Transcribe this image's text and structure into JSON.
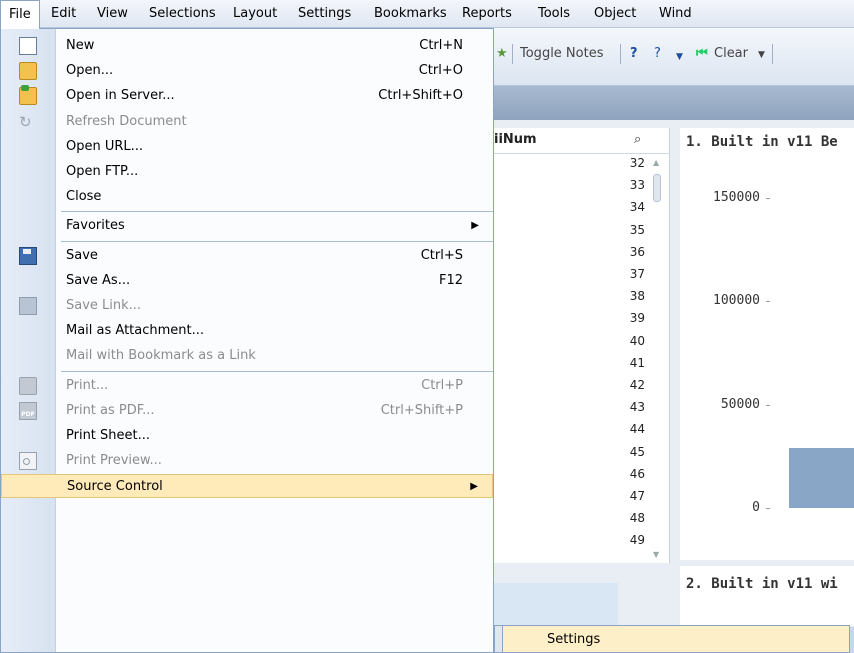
{
  "menubar": {
    "items": [
      "File",
      "Edit",
      "View",
      "Selections",
      "Layout",
      "Settings",
      "Bookmarks",
      "Reports",
      "Tools",
      "Object",
      "Wind"
    ]
  },
  "toolbar": {
    "toggle_notes": "Toggle Notes",
    "help_q": "?",
    "clear": "Clear"
  },
  "listbox": {
    "title": "iiNum",
    "search_icon": "search-icon",
    "values": [
      "32",
      "33",
      "34",
      "35",
      "36",
      "37",
      "38",
      "39",
      "40",
      "41",
      "42",
      "43",
      "44",
      "45",
      "46",
      "47",
      "48",
      "49"
    ]
  },
  "chart_data": {
    "type": "bar",
    "title": "1. Built in v11 Be",
    "yticks": [
      "150000",
      "100000",
      "50000",
      "0"
    ],
    "ylim": [
      0,
      150000
    ],
    "values": [
      29000
    ]
  },
  "chart2": {
    "title": "2. Built in v11 wi"
  },
  "file_menu": {
    "items": [
      {
        "label": "New",
        "shortcut": "Ctrl+N",
        "icon": "new-document-icon",
        "disabled": false
      },
      {
        "label": "Open...",
        "shortcut": "Ctrl+O",
        "icon": "open-folder-icon",
        "disabled": false
      },
      {
        "label": "Open in Server...",
        "shortcut": "Ctrl+Shift+O",
        "icon": "open-server-icon",
        "disabled": false
      },
      {
        "label": "Refresh Document",
        "shortcut": "",
        "icon": "refresh-icon",
        "disabled": true
      },
      {
        "label": "Open URL...",
        "shortcut": "",
        "icon": "",
        "disabled": false
      },
      {
        "label": "Open FTP...",
        "shortcut": "",
        "icon": "",
        "disabled": false
      },
      {
        "label": "Close",
        "shortcut": "",
        "icon": "",
        "disabled": false
      },
      {
        "label": "Favorites",
        "shortcut": "",
        "icon": "",
        "disabled": false,
        "submenu": true
      },
      {
        "label": "Save",
        "shortcut": "Ctrl+S",
        "icon": "save-icon",
        "disabled": false
      },
      {
        "label": "Save As...",
        "shortcut": "F12",
        "icon": "",
        "disabled": false
      },
      {
        "label": "Save Link...",
        "shortcut": "",
        "icon": "save-link-icon",
        "disabled": true
      },
      {
        "label": "Mail as Attachment...",
        "shortcut": "",
        "icon": "",
        "disabled": false
      },
      {
        "label": "Mail with Bookmark as a Link",
        "shortcut": "",
        "icon": "",
        "disabled": true
      },
      {
        "label": "Print...",
        "shortcut": "Ctrl+P",
        "icon": "print-icon",
        "disabled": true
      },
      {
        "label": "Print as PDF...",
        "shortcut": "Ctrl+Shift+P",
        "icon": "print-pdf-icon",
        "disabled": true
      },
      {
        "label": "Print Sheet...",
        "shortcut": "",
        "icon": "",
        "disabled": false
      },
      {
        "label": "Print Preview...",
        "shortcut": "",
        "icon": "print-preview-icon",
        "disabled": true
      },
      {
        "label": "Source Control",
        "shortcut": "",
        "icon": "",
        "disabled": false,
        "submenu": true,
        "highlighted": true
      }
    ]
  },
  "submenu": {
    "label": "Settings"
  }
}
